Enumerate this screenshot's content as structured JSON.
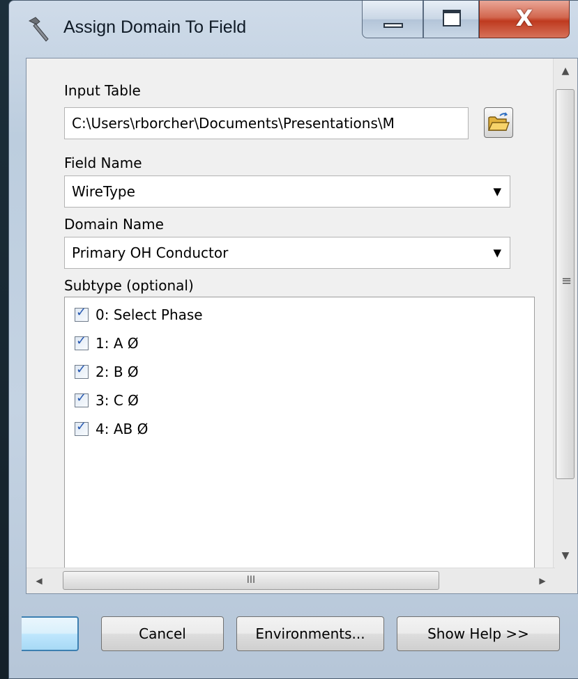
{
  "window": {
    "title": "Assign Domain To Field",
    "title_icon": "hammer-icon",
    "close_glyph": "X"
  },
  "form": {
    "input_table": {
      "label": "Input Table",
      "value": "C:\\Users\\rborcher\\Documents\\Presentations\\M",
      "browse_icon": "folder-open-icon"
    },
    "field_name": {
      "label": "Field Name",
      "value": "WireType"
    },
    "domain_name": {
      "label": "Domain Name",
      "value": "Primary OH Conductor"
    },
    "subtype": {
      "label": "Subtype (optional)",
      "items": [
        {
          "label": "0: Select Phase",
          "checked": true
        },
        {
          "label": "1: A Ø",
          "checked": true
        },
        {
          "label": "2: B Ø",
          "checked": true
        },
        {
          "label": "3: C Ø",
          "checked": true
        },
        {
          "label": "4: AB Ø",
          "checked": true
        }
      ]
    }
  },
  "scrollbars": {
    "v_up": "▲",
    "v_down": "▼",
    "v_grip": "≡",
    "h_left": "◀",
    "h_right": "▶",
    "h_grip": "III"
  },
  "buttons": {
    "ok": "",
    "cancel": "Cancel",
    "environments": "Environments...",
    "show_help": "Show Help >>"
  },
  "colors": {
    "close_button": "#c7452a",
    "checkmark": "#2557b0",
    "focused_button_border": "#3c7fb1"
  }
}
